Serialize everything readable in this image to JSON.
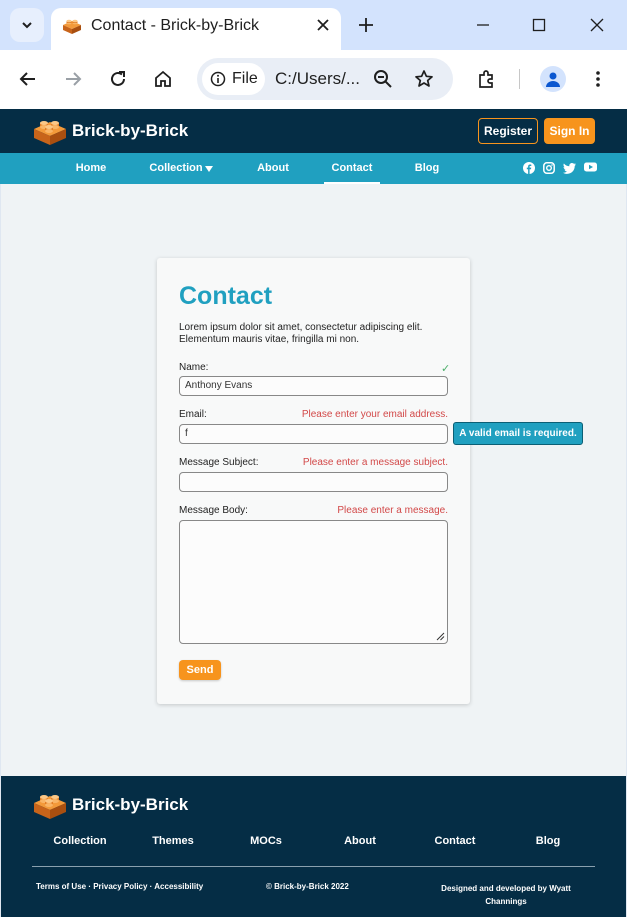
{
  "browser": {
    "tab_title": "Contact - Brick-by-Brick",
    "site_info_label": "File",
    "url": "C:/Users/..."
  },
  "site": {
    "brand": "Brick-by-Brick",
    "register_label": "Register",
    "signin_label": "Sign In",
    "nav": [
      {
        "label": "Home"
      },
      {
        "label": "Collection"
      },
      {
        "label": "About"
      },
      {
        "label": "Contact",
        "active": true
      },
      {
        "label": "Blog"
      }
    ],
    "socials": [
      "facebook-icon",
      "instagram-icon",
      "twitter-icon",
      "youtube-icon"
    ]
  },
  "form": {
    "title": "Contact",
    "intro": "Lorem ipsum dolor sit amet, consectetur adipiscing elit. Elementum mauris vitae, fringilla mi non.",
    "name": {
      "label": "Name:",
      "value": "Anthony Evans",
      "status": "✓"
    },
    "email": {
      "label": "Email:",
      "value": "f",
      "error": "Please enter your email address.",
      "tooltip": "A valid email is required."
    },
    "subject": {
      "label": "Message Subject:",
      "value": "",
      "error": "Please enter a message subject."
    },
    "body": {
      "label": "Message Body:",
      "value": "",
      "error": "Please enter a message."
    },
    "send_label": "Send"
  },
  "footer": {
    "brand": "Brick-by-Brick",
    "links": [
      {
        "label": "Collection"
      },
      {
        "label": "Themes"
      },
      {
        "label": "MOCs"
      },
      {
        "label": "About"
      },
      {
        "label": "Contact"
      },
      {
        "label": "Blog"
      }
    ],
    "legal": "Terms of Use · Privacy Policy · Accessibility",
    "copyright": "© Brick-by-Brick 2022",
    "credit": "Designed and developed by Wyatt Channings"
  },
  "colors": {
    "navy": "#052d45",
    "teal": "#20a0c0",
    "orange": "#f7941d",
    "error": "#d24848",
    "ok": "#4cae6a"
  }
}
